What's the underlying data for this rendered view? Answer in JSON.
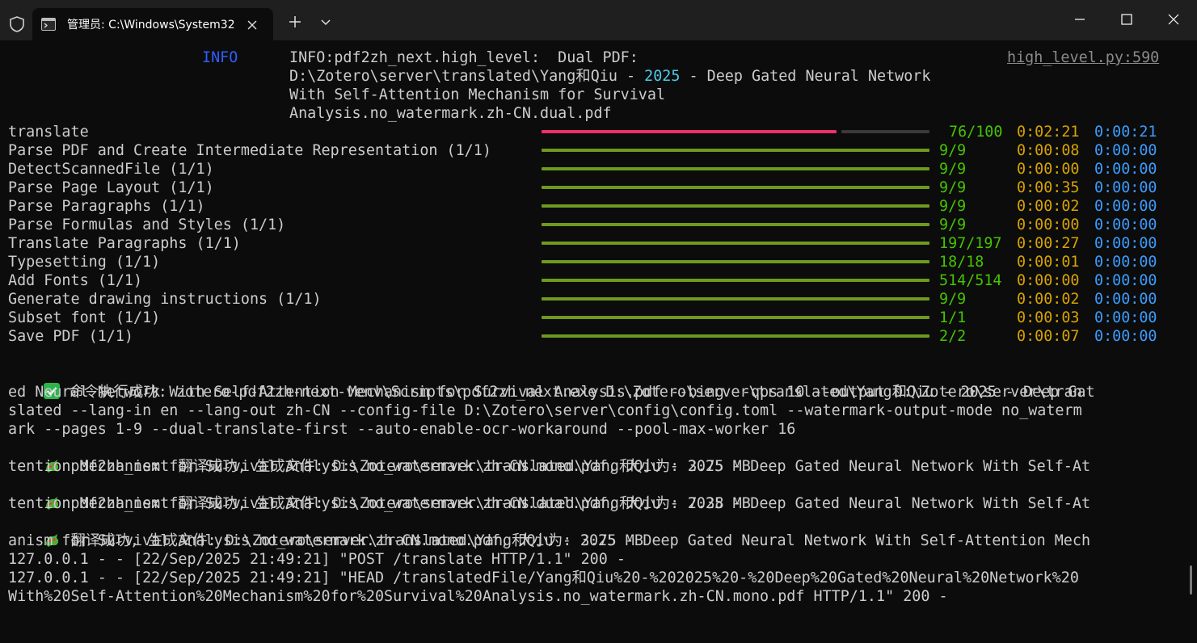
{
  "window": {
    "tab_title": "管理员: C:\\Windows\\System32",
    "new_tab_icon": "plus-icon",
    "dropdown_icon": "chevron-down-icon"
  },
  "colors": {
    "background": "#0c0c0c",
    "titlebar": "#1f1f1f",
    "info_blue": "#2f5fff",
    "count_green": "#45c400",
    "elapsed_gold": "#d7a300",
    "remaining_blue": "#3b9cff",
    "bar_green": "#6e9a1e",
    "bar_pink": "#f0306a"
  },
  "log": {
    "level": "INFO",
    "line1": "INFO:pdf2zh_next.high_level:  Dual PDF:",
    "source": "high_level.py:590",
    "line2_prefix": "D:\\Zotero\\server\\translated\\Yang和Qiu - ",
    "line2_year": "2025",
    "line2_suffix": " - Deep Gated Neural Network",
    "line3": "With Self-Attention Mechanism for Survival",
    "line4": "Analysis.no_watermark.zh-CN.dual.pdf"
  },
  "progress": [
    {
      "label": "translate",
      "count": "76/100",
      "elapsed": "0:02:21",
      "remaining": "0:00:21",
      "fraction": 0.76
    },
    {
      "label": "Parse PDF and Create Intermediate Representation (1/1)",
      "count": "9/9",
      "elapsed": "0:00:08",
      "remaining": "0:00:00",
      "fraction": 1
    },
    {
      "label": "DetectScannedFile (1/1)",
      "count": "9/9",
      "elapsed": "0:00:00",
      "remaining": "0:00:00",
      "fraction": 1
    },
    {
      "label": "Parse Page Layout (1/1)",
      "count": "9/9",
      "elapsed": "0:00:35",
      "remaining": "0:00:00",
      "fraction": 1
    },
    {
      "label": "Parse Paragraphs (1/1)",
      "count": "9/9",
      "elapsed": "0:00:02",
      "remaining": "0:00:00",
      "fraction": 1
    },
    {
      "label": "Parse Formulas and Styles (1/1)",
      "count": "9/9",
      "elapsed": "0:00:00",
      "remaining": "0:00:00",
      "fraction": 1
    },
    {
      "label": "Translate Paragraphs (1/1)",
      "count": "197/197",
      "elapsed": "0:00:27",
      "remaining": "0:00:00",
      "fraction": 1
    },
    {
      "label": "Typesetting (1/1)",
      "count": "18/18",
      "elapsed": "0:00:01",
      "remaining": "0:00:00",
      "fraction": 1
    },
    {
      "label": "Add Fonts (1/1)",
      "count": "514/514",
      "elapsed": "0:00:00",
      "remaining": "0:00:00",
      "fraction": 1
    },
    {
      "label": "Generate drawing instructions (1/1)",
      "count": "9/9",
      "elapsed": "0:00:02",
      "remaining": "0:00:00",
      "fraction": 1
    },
    {
      "label": "Subset font (1/1)",
      "count": "1/1",
      "elapsed": "0:00:03",
      "remaining": "0:00:00",
      "fraction": 1
    },
    {
      "label": "Save PDF (1/1)",
      "count": "2/2",
      "elapsed": "0:00:07",
      "remaining": "0:00:00",
      "fraction": 1
    }
  ],
  "output": {
    "cmd_lines": [
      " 命令执行成功: zotero-pdf2zh-next-venv\\Scripts\\pdf2zh_next.exe D:\\Zotero\\server\\translated\\Yang和Qiu - 2025 - Deep Gat",
      "ed Neural Network With Self-Attention Mechanism for Survival Analysis.pdf --bing --qps 10 --output D:\\Zotero\\server\\tran",
      "slated --lang-in en --lang-out zh-CN --config-file D:\\Zotero\\server\\config\\config.toml --watermark-output-mode no_waterm",
      "ark --pages 1-9 --dual-translate-first --auto-enable-ocr-workaround --pool-max-worker 16"
    ],
    "result1": [
      " pdf2zh_next 翻译成功, 生成文件: D:\\Zotero\\server\\translated\\Yang和Qiu - 2025 - Deep Gated Neural Network With Self-At",
      "tention Mechanism for Survival Analysis.no_watermark.zh-CN.mono.pdf, 大小为: 3.75 MB"
    ],
    "result2": [
      " pdf2zh_next 翻译成功, 生成文件: D:\\Zotero\\server\\translated\\Yang和Qiu - 2025 - Deep Gated Neural Network With Self-At",
      "tention Mechanism for Survival Analysis.no_watermark.zh-CN.dual.pdf, 大小为: 7.38 MB"
    ],
    "result3": [
      " 翻译成功, 生成文件: D:\\Zotero\\server\\translated\\Yang和Qiu - 2025 - Deep Gated Neural Network With Self-Attention Mech",
      "anism for Survival Analysis.no_watermark.zh-CN.mono.pdf, 大小为: 3.75 MB"
    ],
    "http_lines": [
      "127.0.0.1 - - [22/Sep/2025 21:49:21] \"POST /translate HTTP/1.1\" 200 -",
      "127.0.0.1 - - [22/Sep/2025 21:49:21] \"HEAD /translatedFile/Yang和Qiu%20-%202025%20-%20Deep%20Gated%20Neural%20Network%20",
      "With%20Self-Attention%20Mechanism%20for%20Survival%20Analysis.no_watermark.zh-CN.mono.pdf HTTP/1.1\" 200 -"
    ]
  }
}
